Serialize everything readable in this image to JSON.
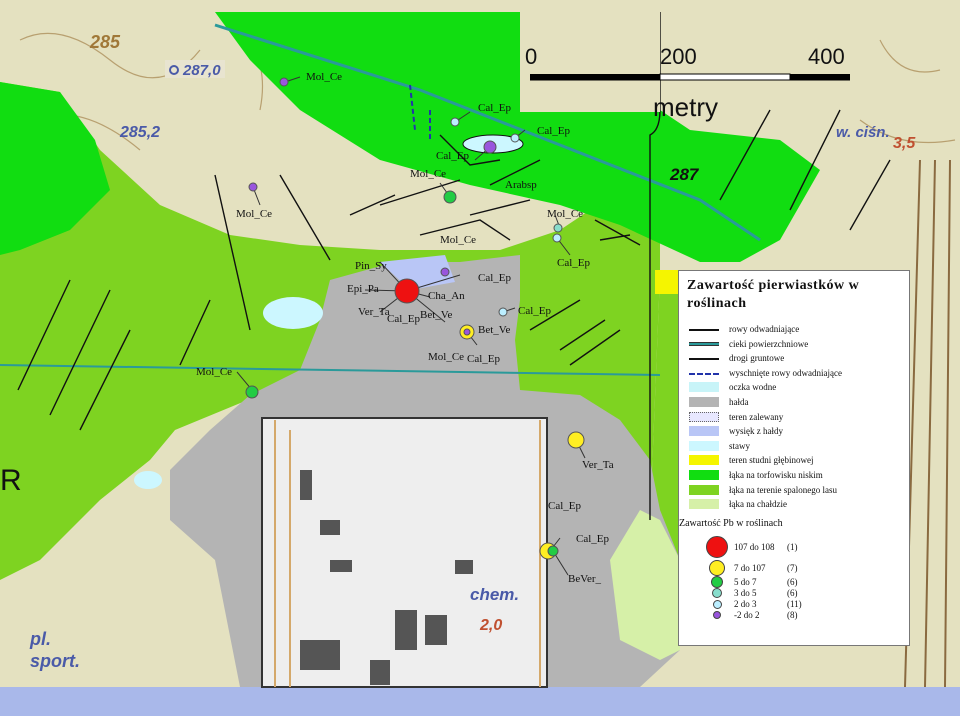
{
  "scale": {
    "tick_0": "0",
    "tick_200": "200",
    "tick_400": "400",
    "unit": "metry"
  },
  "topo_labels": {
    "e285": "285",
    "e287_0": "287,0",
    "e285_2": "285,2",
    "e287": "287",
    "e3_5": "3,5",
    "wcisn": "w. ciśn.",
    "chem": "chem.",
    "e2_0": "2,0",
    "pl": "pl.",
    "sport": "sport.",
    "R": "R"
  },
  "sample_labels": [
    "Mol_Ce",
    "Cal_Ep",
    "Cal_Ep",
    "Cal_Ep",
    "Mol_Ce",
    "Arabsp",
    "Mol_Ce",
    "Mol_Ce",
    "Mol_Ce",
    "Cal_Ep",
    "Pin_Sy",
    "Cal_Ep",
    "Epi_Pa",
    "Cha_An",
    "Ver_Ta",
    "Cal_Ep",
    "Bet_Ve",
    "Cal_Ep",
    "Bet_Ve",
    "Mol_Ce",
    "Cal_Ep",
    "Mol_Ce",
    "Ver_Ta",
    "Cal_Ep",
    "Cal_Ep",
    "BeVer_"
  ],
  "legend": {
    "title": "Zawartość pierwiastków w roślinach",
    "items": [
      {
        "label": "rowy odwadniające",
        "swatch": "line",
        "color": "#111111"
      },
      {
        "label": "cieki powierzchniowe",
        "swatch": "double-line",
        "color": "#2a9a9a"
      },
      {
        "label": "drogi gruntowe",
        "swatch": "line",
        "color": "#111111"
      },
      {
        "label": "wyschnięte rowy odwadniające",
        "swatch": "dashed",
        "color": "#2233aa"
      },
      {
        "label": "oczka wodne",
        "swatch": "fill",
        "color": "#c8f4f8"
      },
      {
        "label": "hałda",
        "swatch": "fill",
        "color": "#b4b4b4"
      },
      {
        "label": "teren zalewany",
        "swatch": "dotted",
        "color": "#e8e8ff"
      },
      {
        "label": "wysięk z hałdy",
        "swatch": "fill",
        "color": "#b9c6f6"
      },
      {
        "label": "stawy",
        "swatch": "fill",
        "color": "#ccf7ff"
      },
      {
        "label": "teren studni głębinowej",
        "swatch": "fill",
        "color": "#f5f500"
      },
      {
        "label": "łąka na torfowisku niskim",
        "swatch": "fill",
        "color": "#11dd11"
      },
      {
        "label": "łąka na terenie spalonego lasu",
        "swatch": "fill",
        "color": "#7ed321"
      },
      {
        "label": "łąka na chałdzie",
        "swatch": "fill",
        "color": "#d6f0a8"
      }
    ],
    "pb_title": "Zawartość Pb w roślinach",
    "pb_classes": [
      {
        "range": "107 do 108",
        "count": "(1)",
        "color": "#ee1111"
      },
      {
        "range": "7 do 107",
        "count": "(7)",
        "color": "#ffee22"
      },
      {
        "range": "5 do 7",
        "count": "(6)",
        "color": "#22cc44"
      },
      {
        "range": "3 do 5",
        "count": "(6)",
        "color": "#88ddcc"
      },
      {
        "range": "2 do 3",
        "count": "(11)",
        "color": "#bbeeff"
      },
      {
        "range": "-2 do 2",
        "count": "(8)",
        "color": "#9955dd"
      }
    ]
  }
}
